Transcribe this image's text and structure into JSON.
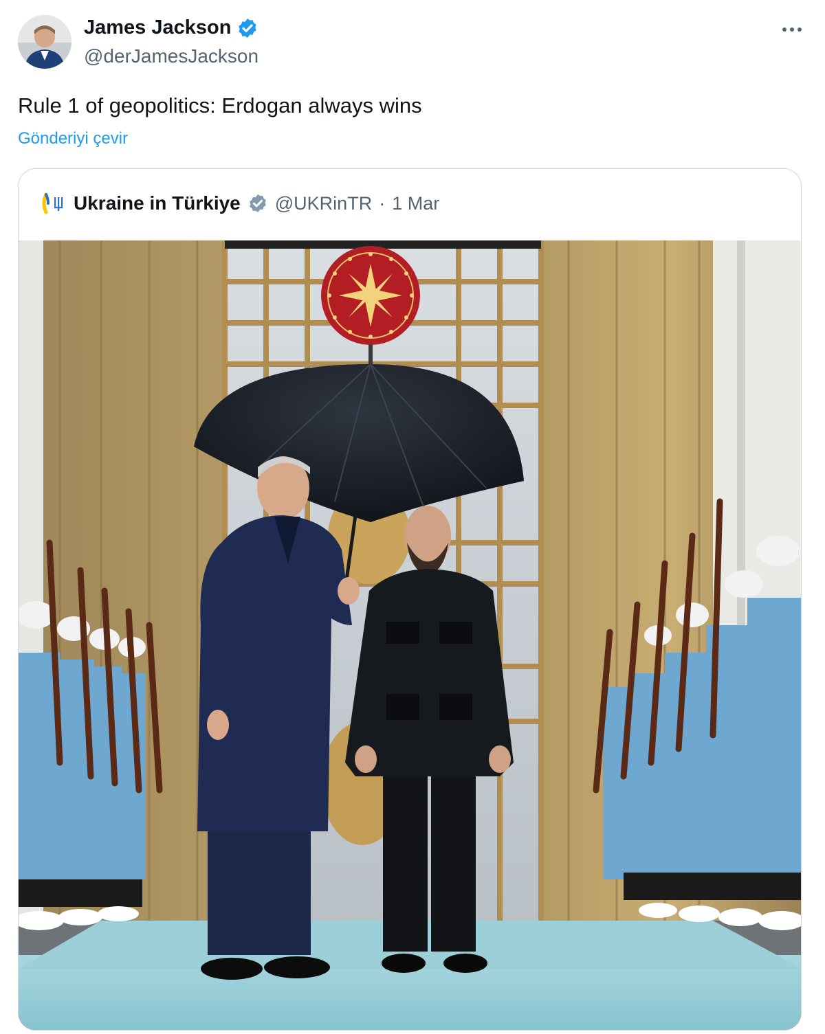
{
  "author": {
    "name": "James Jackson",
    "handle": "@derJamesJackson",
    "avatar_icon": "profile-avatar",
    "verified_icon": "verified-badge-icon"
  },
  "tweet": {
    "text": "Rule 1 of geopolitics: Erdogan always wins",
    "translate_label": "Gönderiyi çevir"
  },
  "menu": {
    "more_icon": "more-options-icon"
  },
  "quote": {
    "name": "Ukraine in Türkiye",
    "handle": "@UKRinTR",
    "separator": "·",
    "date": "1 Mar",
    "flag_icon": "ukraine-flag-icon",
    "photo_icon": "press-photo"
  },
  "colors": {
    "text": "#0f1419",
    "secondary": "#536471",
    "link": "#1d9bf0",
    "border": "#cfd9de",
    "verified": "#1d9bf0"
  }
}
